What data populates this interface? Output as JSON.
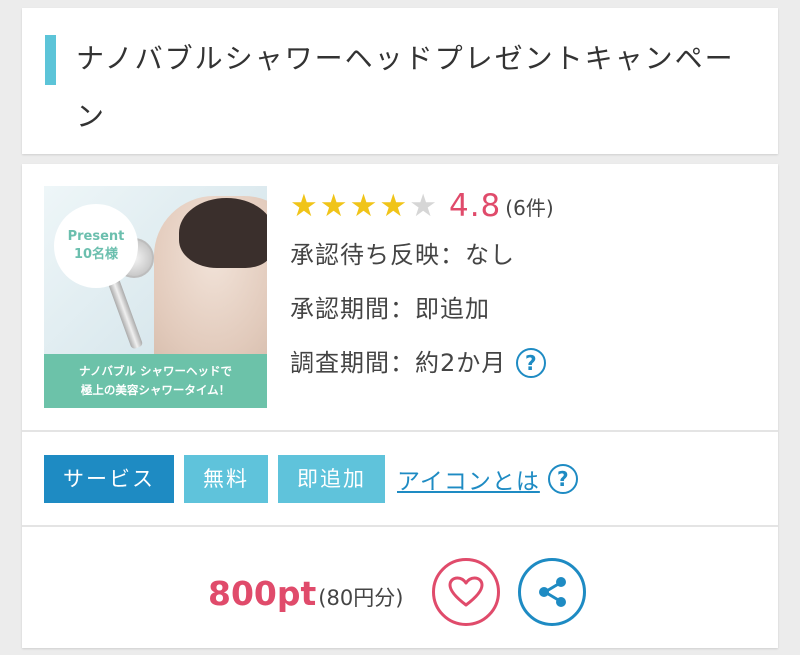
{
  "campaign": {
    "title": "ナノバブルシャワーヘッドプレゼントキャンペーン"
  },
  "banner": {
    "present_label": "Present",
    "present_count": "10名様",
    "caption_line1": "ナノバブル シャワーヘッドで",
    "caption_line2": "極上の美容シャワータイム！"
  },
  "rating": {
    "stars_filled": 4,
    "stars_total": 5,
    "value": "4.8",
    "count": "(6件)"
  },
  "details": {
    "approval_wait": "承認待ち反映：なし",
    "approval_period": "承認期間：即追加",
    "survey_period": "調査期間：約2か月"
  },
  "tags": {
    "service": "サービス",
    "free": "無料",
    "instant": "即追加",
    "icon_help_link": "アイコンとは"
  },
  "reward": {
    "points": "800pt",
    "yen": "(80円分)"
  },
  "colors": {
    "accent_blue": "#1e8bc3",
    "light_blue": "#5fc3db",
    "title_bar": "#5cc4d8",
    "rating_pink": "#e04b6b",
    "star_yellow": "#f0c419",
    "banner_green": "#6cc2a9"
  },
  "icons": {
    "help": "question-circle-icon",
    "favorite": "heart-icon",
    "share": "share-icon"
  }
}
